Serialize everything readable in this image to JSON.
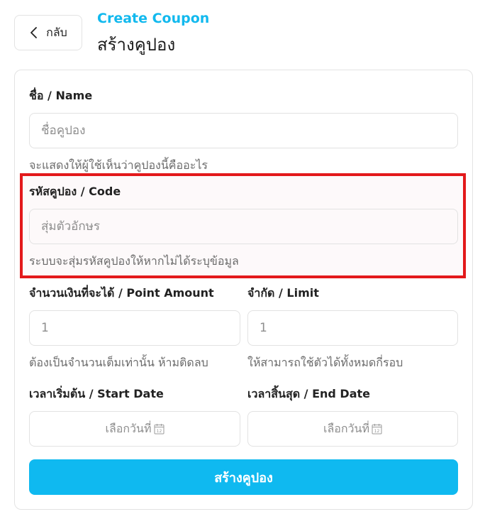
{
  "header": {
    "back_label": "กลับ",
    "subtitle": "Create Coupon",
    "title": "สร้างคูปอง"
  },
  "form": {
    "name": {
      "label": "ชื่อ / Name",
      "placeholder": "ชื่อคูปอง",
      "value": "",
      "hint": "จะแสดงให้ผู้ใช้เห็นว่าคูปองนี้คืออะไร"
    },
    "code": {
      "label": "รหัสคูปอง / Code",
      "placeholder": "สุ่มตัวอักษร",
      "value": "",
      "hint": "ระบบจะสุ่มรหัสคูปองให้หากไม่ได้ระบุข้อมูล"
    },
    "point_amount": {
      "label": "จำนวนเงินที่จะได้ / Point Amount",
      "placeholder": "1",
      "value": "",
      "hint": "ต้องเป็นจำนวนเต็มเท่านั้น ห้ามติดลบ"
    },
    "limit": {
      "label": "จำกัด / Limit",
      "placeholder": "1",
      "value": "",
      "hint": "ให้สามารถใช้ตัวได้ทั้งหมดกี่รอบ"
    },
    "start_date": {
      "label": "เวลาเริ่มต้น / Start Date",
      "placeholder": "เลือกวันที่"
    },
    "end_date": {
      "label": "เวลาสิ้นสุด / End Date",
      "placeholder": "เลือกวันที่"
    },
    "submit_label": "สร้างคูปอง"
  },
  "icons": {
    "back": "chevron-left-icon",
    "calendar": "calendar-icon"
  },
  "colors": {
    "accent": "#0fb9f0",
    "subtitle": "#12b9ee",
    "highlight_border": "#e3191b"
  }
}
